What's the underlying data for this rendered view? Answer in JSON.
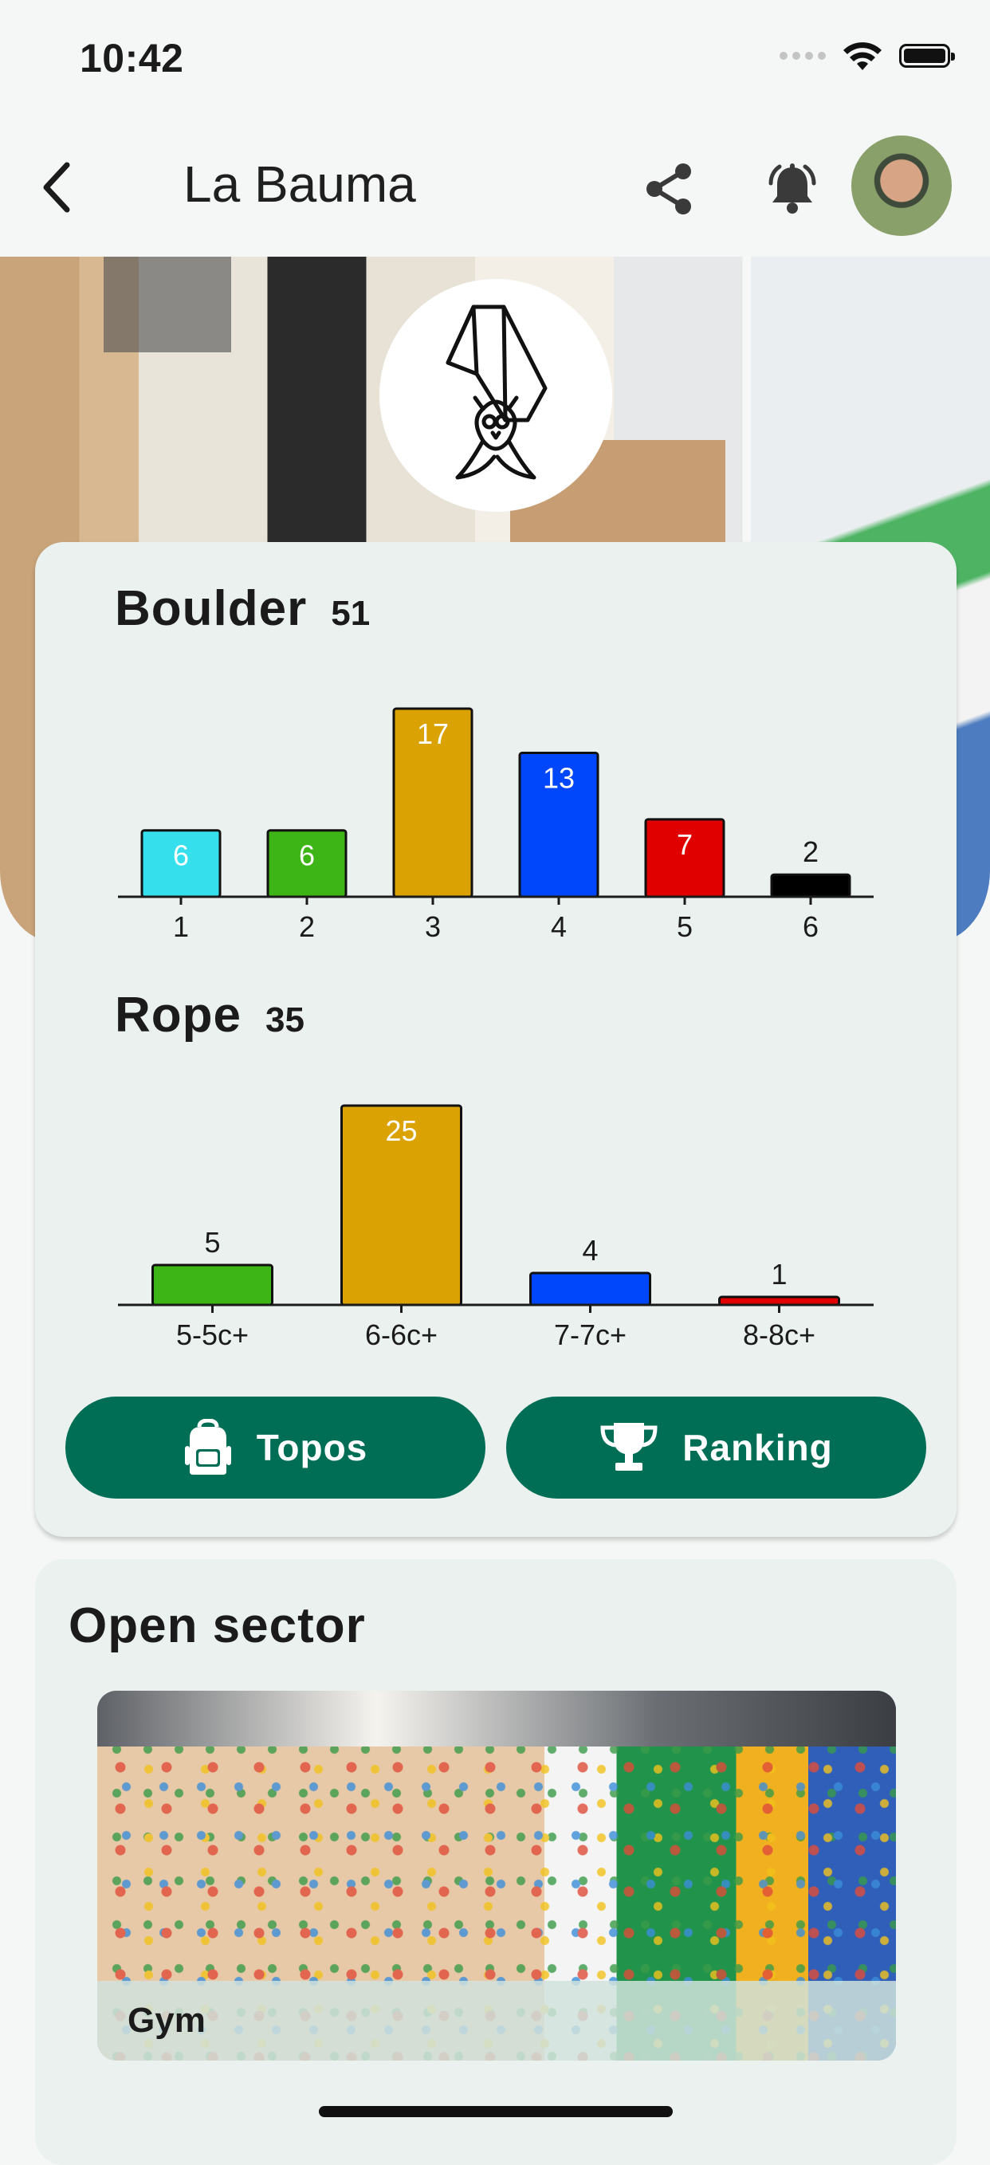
{
  "status_bar": {
    "time": "10:42"
  },
  "app_bar": {
    "title": "La Bauma",
    "back_icon": "chevron-left-icon",
    "share_icon": "share-icon",
    "notify_icon": "bell-ringing-icon"
  },
  "colors": {
    "primary": "#006d55",
    "card_bg": "#eaf1ef",
    "page_bg": "#f4f7f5"
  },
  "boulder": {
    "title": "Boulder",
    "count": "51"
  },
  "rope": {
    "title": "Rope",
    "count": "35"
  },
  "chart_data": [
    {
      "type": "bar",
      "title": "Boulder",
      "categories": [
        "1",
        "2",
        "3",
        "4",
        "5",
        "6"
      ],
      "values": [
        6,
        6,
        17,
        13,
        7,
        2
      ],
      "colors": [
        "#35e0ec",
        "#3eb516",
        "#dba203",
        "#0047fb",
        "#e00000",
        "#000000"
      ]
    },
    {
      "type": "bar",
      "title": "Rope",
      "categories": [
        "5-5c+",
        "6-6c+",
        "7-7c+",
        "8-8c+"
      ],
      "values": [
        5,
        25,
        4,
        1
      ],
      "colors": [
        "#3eb516",
        "#dba203",
        "#0047fb",
        "#e00000"
      ]
    }
  ],
  "actions": {
    "topos_label": "Topos",
    "ranking_label": "Ranking"
  },
  "sector": {
    "title": "Open sector",
    "items": [
      {
        "label": "Gym"
      }
    ]
  }
}
